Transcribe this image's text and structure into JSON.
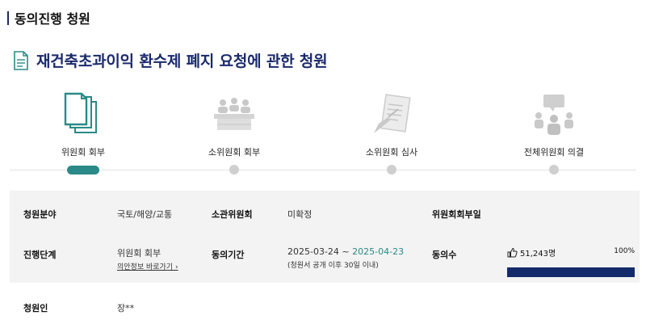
{
  "section": {
    "title": "동의진행 청원"
  },
  "petition": {
    "title": "재건축초과이익 환수제 폐지 요청에 관한 청원",
    "icon": "document-icon"
  },
  "steps": [
    {
      "label": "위원회 회부",
      "icon": "documents-stack-icon",
      "active": true
    },
    {
      "label": "소위원회 회부",
      "icon": "meeting-table-icon",
      "active": false
    },
    {
      "label": "소위원회 심사",
      "icon": "review-document-icon",
      "active": false
    },
    {
      "label": "전체위원회 의결",
      "icon": "discussion-group-icon",
      "active": false
    }
  ],
  "info": {
    "field_label": "청원분야",
    "field_value": "국토/해양/교통",
    "committee_label": "소관위원회",
    "committee_value": "미확정",
    "referral_label": "위원회회부일",
    "referral_value": "",
    "stage_label": "진행단계",
    "stage_value": "위원회 회부",
    "stage_link": "의안정보 바로가기 ›",
    "period_label": "동의기간",
    "period_start": "2025-03-24 ~ ",
    "period_end": "2025-04-23",
    "period_note": "(청원서 공개 이후 30일 이내)",
    "agree_label": "동의수",
    "agree_count": "51,243명",
    "agree_percent": "100%",
    "agree_fraction": 1.0
  },
  "petitioner": {
    "label": "청원인",
    "value": "장**"
  },
  "colors": {
    "accent": "#2a8a87",
    "navy": "#142a6a",
    "title": "#1a2a6c"
  }
}
